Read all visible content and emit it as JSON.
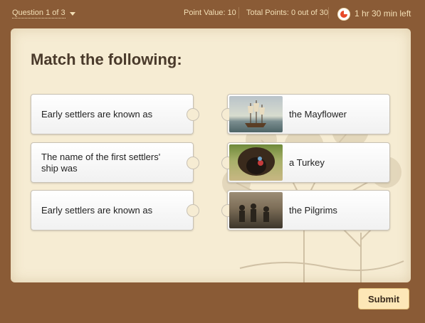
{
  "header": {
    "question_label": "Question 1 of 3",
    "point_value": "Point Value: 10",
    "total_points": "Total Points: 0 out of 30",
    "time_left": "1 hr 30 min left"
  },
  "question": {
    "title": "Match the following:",
    "left_items": [
      {
        "text": "Early settlers are known as"
      },
      {
        "text": "The name of the first settlers' ship was"
      },
      {
        "text": "Early settlers are known as"
      }
    ],
    "right_items": [
      {
        "text": "the Mayflower",
        "image": "ship-painting"
      },
      {
        "text": "a Turkey",
        "image": "turkey-photo"
      },
      {
        "text": "the Pilgrims",
        "image": "pilgrims-painting"
      }
    ]
  },
  "footer": {
    "submit_label": "Submit"
  },
  "colors": {
    "frame": "#8a5b36",
    "panel": "#f6ecd3",
    "header_text": "#f3dfb6",
    "submit_bg": "#fde7b7",
    "timer_red": "#e84a2a"
  },
  "icons": {
    "dropdown": "caret-down-icon",
    "timer": "timer-pie-icon"
  }
}
